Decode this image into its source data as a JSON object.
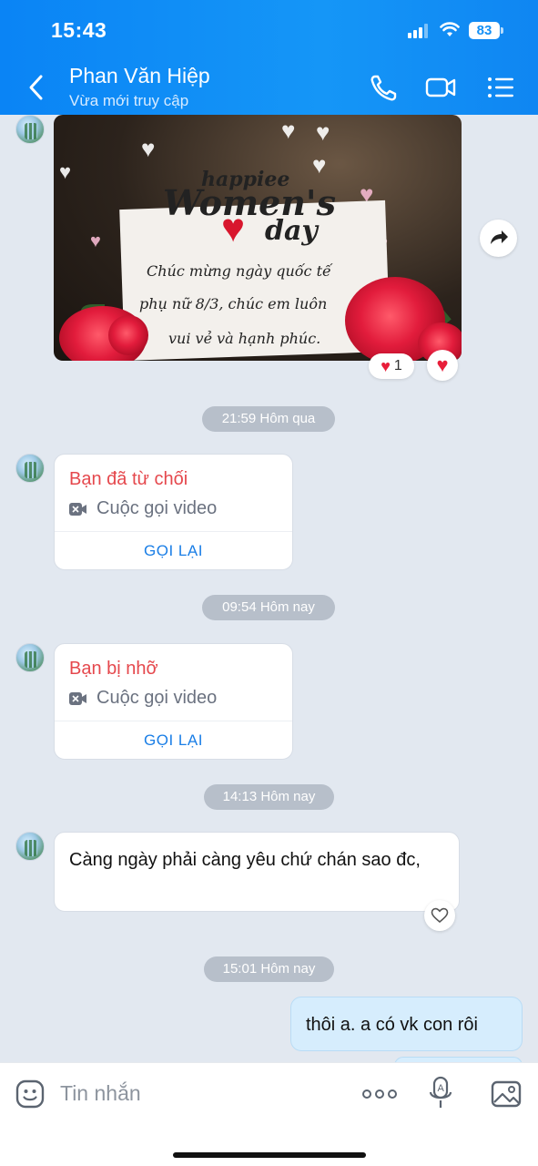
{
  "status_bar": {
    "time": "15:43",
    "battery": "83"
  },
  "header": {
    "contact_name": "Phan Văn Hiệp",
    "status": "Vừa mới truy cập"
  },
  "image_message": {
    "greeting_top": "happiee",
    "greeting_main": "Women's",
    "greeting_day": "day",
    "wish_line1": "Chúc mừng ngày quốc tế",
    "wish_line2": "phụ nữ 8/3, chúc em luôn",
    "wish_line3": "vui vẻ và hạnh phúc.",
    "reaction_count": "1"
  },
  "timestamps": [
    "21:59 Hôm qua",
    "09:54 Hôm nay",
    "14:13 Hôm nay",
    "15:01 Hôm nay"
  ],
  "calls": [
    {
      "title": "Bạn đã từ chối",
      "type": "Cuộc gọi video",
      "action": "GỌI LẠI"
    },
    {
      "title": "Bạn bị nhỡ",
      "type": "Cuộc gọi video",
      "action": "GỌI LẠI"
    }
  ],
  "messages": {
    "incoming_text": "Càng ngày phải càng yêu chứ chán sao đc,",
    "outgoing_text": "thôi a. a có vk con rôi"
  },
  "input": {
    "placeholder": "Tin nhắn"
  },
  "colors": {
    "header_blue": "#0a84f5",
    "missed_red": "#e5484d",
    "link_blue": "#1a7ee6",
    "outgoing_bubble": "#d6edfd"
  }
}
